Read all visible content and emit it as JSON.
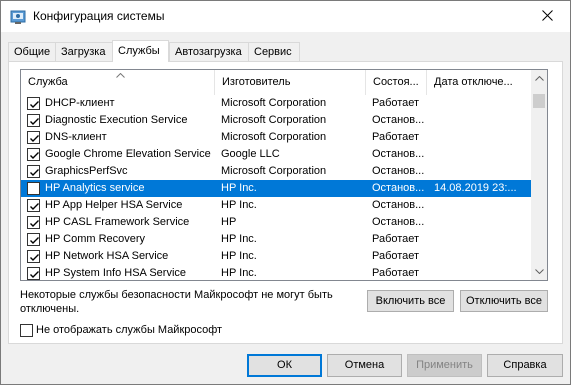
{
  "window": {
    "title": "Конфигурация системы",
    "close_glyph": "✕"
  },
  "tabs": [
    {
      "label": "Общие",
      "active": false
    },
    {
      "label": "Загрузка",
      "active": false
    },
    {
      "label": "Службы",
      "active": true
    },
    {
      "label": "Автозагрузка",
      "active": false
    },
    {
      "label": "Сервис",
      "active": false
    }
  ],
  "services": {
    "columns": {
      "name": "Служба",
      "manufacturer": "Изготовитель",
      "status": "Состоя...",
      "disabled_date": "Дата отключе..."
    },
    "rows": [
      {
        "checked": true,
        "name": "DHCP-клиент",
        "manufacturer": "Microsoft Corporation",
        "status": "Работает",
        "date": "",
        "selected": false
      },
      {
        "checked": true,
        "name": "Diagnostic Execution Service",
        "manufacturer": "Microsoft Corporation",
        "status": "Останов...",
        "date": "",
        "selected": false
      },
      {
        "checked": true,
        "name": "DNS-клиент",
        "manufacturer": "Microsoft Corporation",
        "status": "Работает",
        "date": "",
        "selected": false
      },
      {
        "checked": true,
        "name": "Google Chrome Elevation Service",
        "manufacturer": "Google LLC",
        "status": "Останов...",
        "date": "",
        "selected": false
      },
      {
        "checked": true,
        "name": "GraphicsPerfSvc",
        "manufacturer": "Microsoft Corporation",
        "status": "Останов...",
        "date": "",
        "selected": false
      },
      {
        "checked": false,
        "name": "HP Analytics service",
        "manufacturer": "HP Inc.",
        "status": "Останов...",
        "date": "14.08.2019 23:...",
        "selected": true
      },
      {
        "checked": true,
        "name": "HP App Helper HSA Service",
        "manufacturer": "HP Inc.",
        "status": "Останов...",
        "date": "",
        "selected": false
      },
      {
        "checked": true,
        "name": "HP CASL Framework Service",
        "manufacturer": "HP",
        "status": "Останов...",
        "date": "",
        "selected": false
      },
      {
        "checked": true,
        "name": "HP Comm Recovery",
        "manufacturer": "HP Inc.",
        "status": "Работает",
        "date": "",
        "selected": false
      },
      {
        "checked": true,
        "name": "HP Network HSA Service",
        "manufacturer": "HP Inc.",
        "status": "Работает",
        "date": "",
        "selected": false
      },
      {
        "checked": true,
        "name": "HP System Info HSA Service",
        "manufacturer": "HP Inc.",
        "status": "Работает",
        "date": "",
        "selected": false
      }
    ]
  },
  "note": {
    "text": "Некоторые службы безопасности Майкрософт не могут быть отключены."
  },
  "buttons": {
    "enable_all": "Включить все",
    "disable_all": "Отключить все",
    "ok": "ОК",
    "cancel": "Отмена",
    "apply": "Применить",
    "help": "Справка"
  },
  "hide_ms": {
    "label": "Не отображать службы Майкрософт",
    "checked": false
  },
  "colors": {
    "selection": "#0078d7",
    "window_bg": "#f0f0f0"
  }
}
